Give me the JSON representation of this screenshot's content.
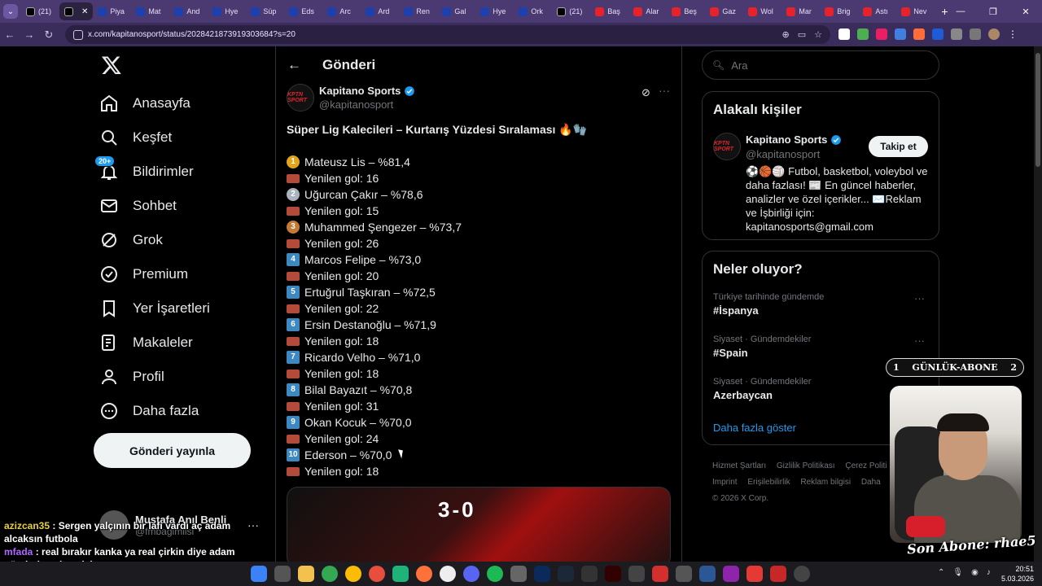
{
  "browser": {
    "tabs": [
      {
        "label": "(21)",
        "fav": "x",
        "active": false
      },
      {
        "label": "",
        "fav": "x",
        "active": true
      },
      {
        "label": "Piya",
        "fav": "blue"
      },
      {
        "label": "Mat",
        "fav": "blue"
      },
      {
        "label": "And",
        "fav": "blue"
      },
      {
        "label": "Hye",
        "fav": "blue"
      },
      {
        "label": "Süp",
        "fav": "blue"
      },
      {
        "label": "Eds",
        "fav": "blue"
      },
      {
        "label": "Arc",
        "fav": "blue"
      },
      {
        "label": "Ard",
        "fav": "blue"
      },
      {
        "label": "Ren",
        "fav": "blue"
      },
      {
        "label": "Gal",
        "fav": "blue"
      },
      {
        "label": "Hye",
        "fav": "blue"
      },
      {
        "label": "Ork",
        "fav": "blue"
      },
      {
        "label": "(21)",
        "fav": "x"
      },
      {
        "label": "Baş",
        "fav": "yt"
      },
      {
        "label": "Alar",
        "fav": "yt"
      },
      {
        "label": "Beş",
        "fav": "yt"
      },
      {
        "label": "Gaz",
        "fav": "yt"
      },
      {
        "label": "Wol",
        "fav": "yt"
      },
      {
        "label": "Mar",
        "fav": "yt"
      },
      {
        "label": "Brig",
        "fav": "yt"
      },
      {
        "label": "Astı",
        "fav": "yt"
      },
      {
        "label": "Nev",
        "fav": "yt"
      }
    ],
    "url": "x.com/kapitanosport/status/2028421873919303684?s=20"
  },
  "nav": {
    "items": [
      {
        "label": "Anasayfa",
        "icon": "home-icon"
      },
      {
        "label": "Keşfet",
        "icon": "search-icon"
      },
      {
        "label": "Bildirimler",
        "icon": "bell-icon",
        "badge": "20+"
      },
      {
        "label": "Sohbet",
        "icon": "mail-icon"
      },
      {
        "label": "Grok",
        "icon": "grok-icon"
      },
      {
        "label": "Premium",
        "icon": "premium-icon"
      },
      {
        "label": "Yer İşaretleri",
        "icon": "bookmark-icon"
      },
      {
        "label": "Makaleler",
        "icon": "article-icon"
      },
      {
        "label": "Profil",
        "icon": "profile-icon"
      },
      {
        "label": "Daha fazla",
        "icon": "more-circle-icon"
      }
    ],
    "post_button": "Gönderi yayınla",
    "account": {
      "name": "Mustafa Anıl Benli",
      "handle": "@fmbagimlisi"
    }
  },
  "main": {
    "title": "Gönderi",
    "tweet": {
      "author": "Kapitano Sports",
      "handle": "@kapitanosport",
      "avatar_text": "KPTN SPORT",
      "headline": "Süper Lig Kalecileri – Kurtarış Yüzdesi Sıralaması 🔥🧤",
      "rows": [
        {
          "emoji": "gold",
          "mark": "1",
          "text": "Mateusz Lis – %81,4"
        },
        {
          "emoji": "brick",
          "mark": "",
          "text": "Yenilen gol: 16"
        },
        {
          "emoji": "silver",
          "mark": "2",
          "text": "Uğurcan Çakır – %78,6"
        },
        {
          "emoji": "brick",
          "mark": "",
          "text": "Yenilen gol: 15"
        },
        {
          "emoji": "bronze",
          "mark": "3",
          "text": "Muhammed Şengezer – %73,7"
        },
        {
          "emoji": "brick",
          "mark": "",
          "text": "Yenilen gol: 26"
        },
        {
          "emoji": "num",
          "mark": "4",
          "text": "Marcos Felipe – %73,0"
        },
        {
          "emoji": "brick",
          "mark": "",
          "text": "Yenilen gol: 20"
        },
        {
          "emoji": "num",
          "mark": "5",
          "text": "Ertuğrul Taşkıran – %72,5"
        },
        {
          "emoji": "brick",
          "mark": "",
          "text": "Yenilen gol: 22"
        },
        {
          "emoji": "num",
          "mark": "6",
          "text": "Ersin Destanoğlu – %71,9"
        },
        {
          "emoji": "brick",
          "mark": "",
          "text": "Yenilen gol: 18"
        },
        {
          "emoji": "num",
          "mark": "7",
          "text": "Ricardo Velho – %71,0"
        },
        {
          "emoji": "brick",
          "mark": "",
          "text": "Yenilen gol: 18"
        },
        {
          "emoji": "num",
          "mark": "8",
          "text": "Bilal Bayazıt – %70,8"
        },
        {
          "emoji": "brick",
          "mark": "",
          "text": "Yenilen gol: 31"
        },
        {
          "emoji": "num",
          "mark": "9",
          "text": "Okan Kocuk – %70,0"
        },
        {
          "emoji": "brick",
          "mark": "",
          "text": "Yenilen gol: 24"
        },
        {
          "emoji": "num",
          "mark": "10",
          "text": "Ederson – %70,0"
        },
        {
          "emoji": "brick",
          "mark": "",
          "text": "Yenilen gol: 18"
        }
      ],
      "image_score": "3-0"
    }
  },
  "right": {
    "search_placeholder": "Ara",
    "related": {
      "title": "Alakalı kişiler",
      "name": "Kapitano Sports",
      "handle": "@kapitanosport",
      "follow": "Takip et",
      "bio": "⚽🏀🏐 Futbol, basketbol, voleybol ve daha fazlası! 📰 En güncel haberler, analizler ve özel içerikler... ✉️Reklam ve İşbirliği için: kapitanosports@gmail.com"
    },
    "trends": {
      "title": "Neler oluyor?",
      "items": [
        {
          "context": "Türkiye tarihinde gündemde",
          "topic": "#İspanya"
        },
        {
          "context": "Siyaset · Gündemdekiler",
          "topic": "#Spain"
        },
        {
          "context": "Siyaset · Gündemdekiler",
          "topic": "Azerbaycan"
        }
      ],
      "show_more": "Daha fazla göster"
    },
    "footer": [
      "Hizmet Şartları",
      "Gizlilik Politikası",
      "Çerez Politi",
      "Imprint",
      "Erişilebilirlik",
      "Reklam bilgisi",
      "Daha",
      "© 2026 X Corp."
    ]
  },
  "overlay": {
    "abone_left": "1",
    "abone_title": "GÜNLÜK-ABONE",
    "abone_right": "2",
    "son_abone": "Son Abone: rhae5"
  },
  "chat": [
    {
      "user": "azizcan35",
      "msg": ": Sergen yalçının bir lafı vardı aç adam alcaksın futbola"
    },
    {
      "user": "mfada",
      "msg": ": real bırakır kanka ya real çirkin diye adam gönderiyo ahsaajsj"
    }
  ],
  "taskbar": {
    "time": "20:51",
    "date": "5.03.2026"
  }
}
